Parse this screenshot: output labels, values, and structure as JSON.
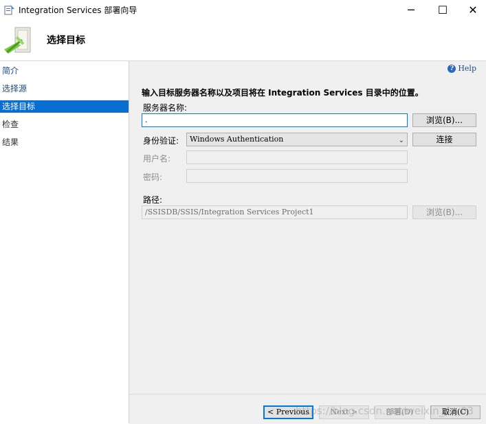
{
  "window": {
    "title": "Integration Services 部署向导",
    "minimize_glyph": "─",
    "maximize_glyph": "☐",
    "close_glyph": "✕"
  },
  "header": {
    "title": "选择目标"
  },
  "sidebar": {
    "items": [
      {
        "label": "简介",
        "state": "link"
      },
      {
        "label": "选择源",
        "state": "link"
      },
      {
        "label": "选择目标",
        "state": "selected"
      },
      {
        "label": "检查",
        "state": "disabled"
      },
      {
        "label": "结果",
        "state": "disabled"
      }
    ]
  },
  "content": {
    "help_label": "Help",
    "instruction": "输入目标服务器名称以及项目将在 Integration Services 目录中的位置。",
    "server_label": "服务器名称:",
    "server_value": ".",
    "browse_label": "浏览(B)...",
    "auth_label": "身份验证:",
    "auth_value": "Windows Authentication",
    "connect_label": "连接",
    "username_label": "用户名:",
    "username_value": "",
    "password_label": "密码:",
    "password_value": "",
    "path_label": "路径:",
    "path_value": "/SSISDB/SSIS/Integration Services Project1",
    "path_browse_label": "浏览(B)..."
  },
  "footer": {
    "previous_label": "< Previous",
    "next_label": "Next >",
    "deploy_label": "部署(D)",
    "cancel_label": "取消(C)"
  },
  "watermark": "https://blog.csdn.net/weixin_4...03"
}
